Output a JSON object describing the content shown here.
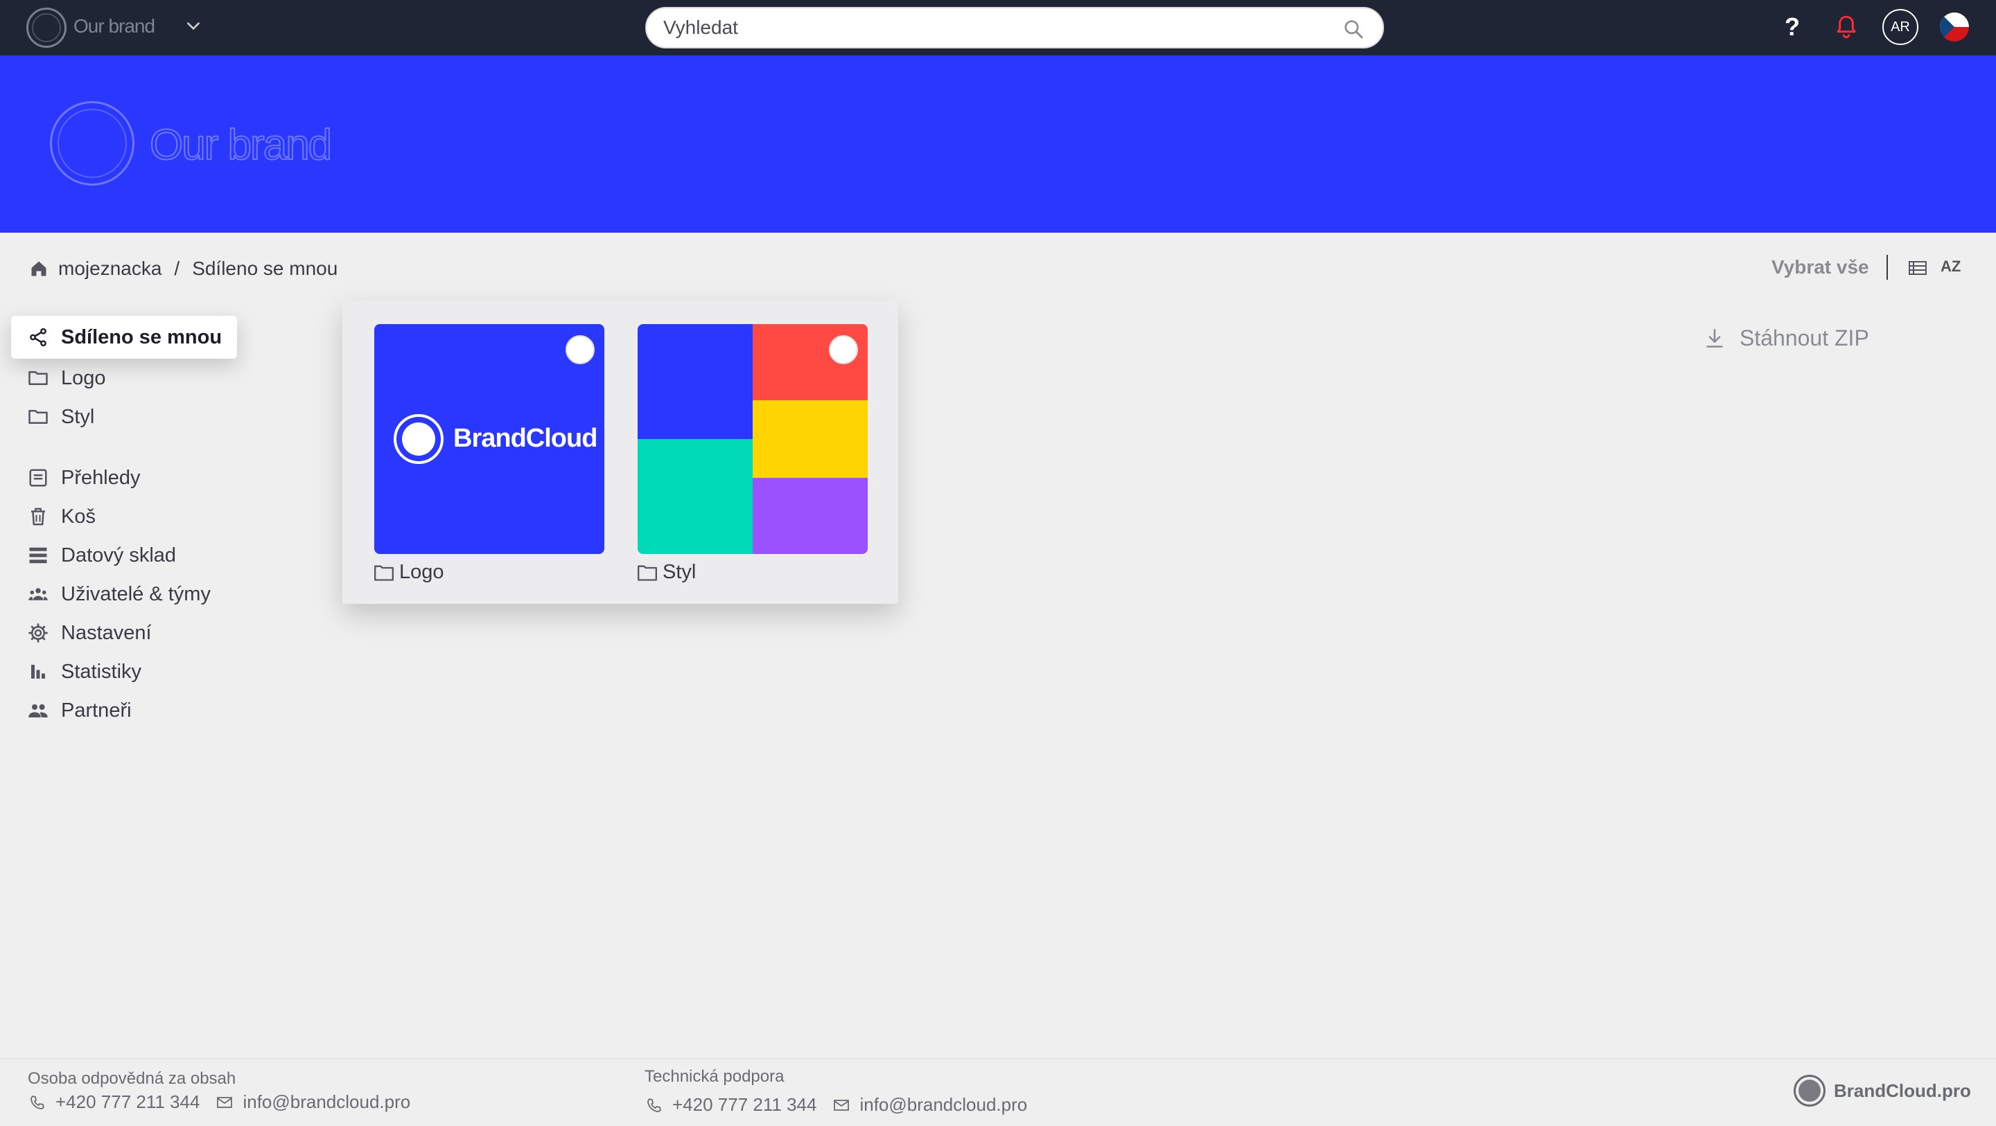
{
  "topbar": {
    "brand": "Our brand",
    "search_placeholder": "Vyhledat",
    "help": "?",
    "avatar_initials": "AR"
  },
  "hero": {
    "brand": "Our brand"
  },
  "breadcrumb": {
    "root": "mojeznacka",
    "separator": "/",
    "current": "Sdíleno se mnou"
  },
  "toolbar": {
    "select_all": "Vybrat vše",
    "sort_label": "AZ"
  },
  "sidebar": {
    "folders": [
      {
        "label": "Sdíleno se mnou",
        "icon": "share-icon"
      },
      {
        "label": "Logo",
        "icon": "folder-icon"
      },
      {
        "label": "Styl",
        "icon": "folder-icon"
      }
    ],
    "nav": [
      {
        "label": "Přehledy",
        "icon": "overview-icon"
      },
      {
        "label": "Koš",
        "icon": "trash-icon"
      },
      {
        "label": "Datový sklad",
        "icon": "database-icon"
      },
      {
        "label": "Uživatelé & týmy",
        "icon": "users-icon"
      },
      {
        "label": "Nastavení",
        "icon": "gear-icon"
      },
      {
        "label": "Statistiky",
        "icon": "chart-icon"
      },
      {
        "label": "Partneři",
        "icon": "partners-icon"
      }
    ]
  },
  "folders": [
    {
      "name": "Logo",
      "thumb_text": "BrandCloud"
    },
    {
      "name": "Styl"
    }
  ],
  "download": {
    "label": "Stáhnout ZIP"
  },
  "footer": {
    "content_owner": {
      "label": "Osoba odpovědná za obsah",
      "phone": "+420 777 211 344",
      "email": "info@brandcloud.pro"
    },
    "support": {
      "label": "Technická podpora",
      "phone": "+420 777 211 344",
      "email": "info@brandcloud.pro"
    },
    "brand": "BrandCloud.pro"
  },
  "colors": {
    "topbar": "#1f2535",
    "hero": "#2a38ff",
    "style_tiles": [
      "#2a38ff",
      "#ff4a44",
      "#00d9b6",
      "#ffd400",
      "#9a52ff"
    ]
  }
}
